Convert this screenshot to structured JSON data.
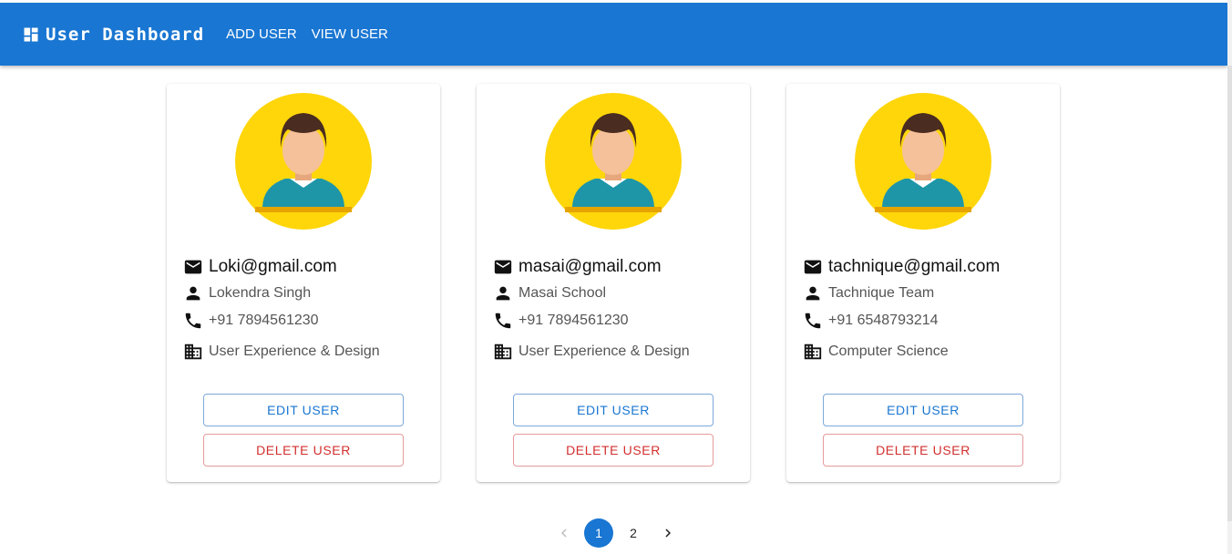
{
  "appbar": {
    "title": "User Dashboard",
    "icon": "dashboard-icon",
    "nav": [
      {
        "label": "ADD USER"
      },
      {
        "label": "VIEW USER"
      }
    ],
    "color": "#1976d2"
  },
  "users": [
    {
      "email": "Loki@gmail.com",
      "name": "Lokendra Singh",
      "phone": "+91 7894561230",
      "department": "User Experience & Design",
      "edit_label": "EDIT USER",
      "delete_label": "DELETE USER"
    },
    {
      "email": "masai@gmail.com",
      "name": "Masai School",
      "phone": "+91 7894561230",
      "department": "User Experience & Design",
      "edit_label": "EDIT USER",
      "delete_label": "DELETE USER"
    },
    {
      "email": "tachnique@gmail.com",
      "name": "Tachnique Team",
      "phone": "+91 6548793214",
      "department": "Computer Science",
      "edit_label": "EDIT USER",
      "delete_label": "DELETE USER"
    }
  ],
  "pagination": {
    "pages": [
      "1",
      "2"
    ],
    "current": "1"
  },
  "colors": {
    "accent": "#1976d2",
    "danger": "#d32f2f",
    "avatar_bg": "#ffd60a"
  }
}
